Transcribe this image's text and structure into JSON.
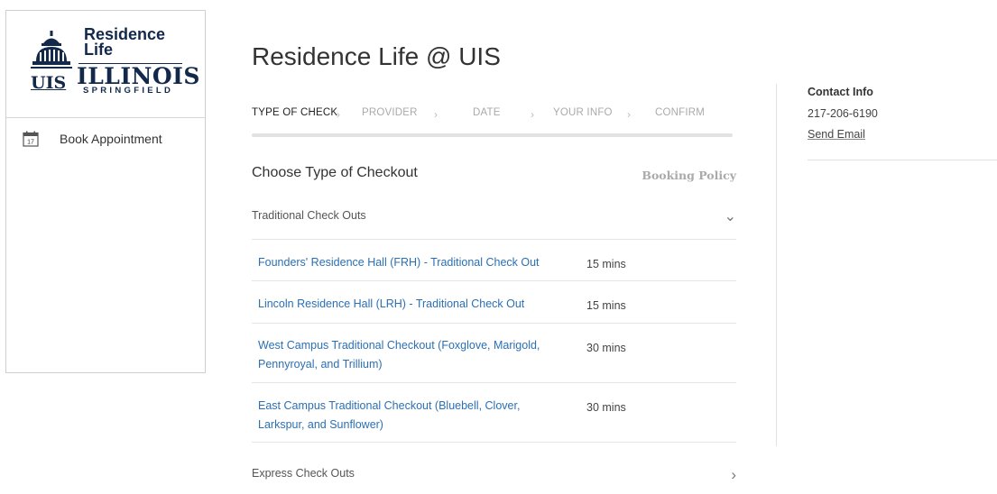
{
  "sidebar": {
    "logo": {
      "line1": "Residence",
      "line2": "Life",
      "illinois": "ILLINOIS",
      "uis": "UIS",
      "springfield": "SPRINGFIELD"
    },
    "nav": [
      {
        "label": "Book Appointment",
        "icon": "calendar-icon",
        "icon_day": "17"
      }
    ]
  },
  "main": {
    "title": "Residence Life @ UIS",
    "steps": [
      "TYPE OF CHECK",
      "PROVIDER",
      "DATE",
      "YOUR INFO",
      "CONFIRM"
    ],
    "active_step": "TYPE OF CHECK",
    "step_separator": "›",
    "section_heading": "Choose Type of Checkout",
    "booking_policy": "Booking Policy",
    "groups": [
      {
        "label": "Traditional Check Outs",
        "expanded": true,
        "chevron": "⌄",
        "services": [
          {
            "name": "Founders' Residence Hall (FRH) - Traditional Check Out",
            "duration": "15 mins"
          },
          {
            "name": "Lincoln Residence Hall (LRH) - Traditional Check Out",
            "duration": "15 mins"
          },
          {
            "name": "West Campus Traditional Checkout (Foxglove, Marigold, Pennyroyal, and Trillium)",
            "duration": "30 mins"
          },
          {
            "name": "East Campus Traditional Checkout (Bluebell, Clover, Larkspur, and Sunflower)",
            "duration": "30 mins"
          }
        ]
      },
      {
        "label": "Express Check Outs",
        "expanded": false,
        "chevron": "›"
      }
    ]
  },
  "contact": {
    "title": "Contact Info",
    "phone": "217-206-6190",
    "email_label": "Send Email"
  },
  "colors": {
    "brand_navy": "#13294b",
    "link_blue": "#2b6fb3",
    "muted": "#aaaaaa"
  }
}
